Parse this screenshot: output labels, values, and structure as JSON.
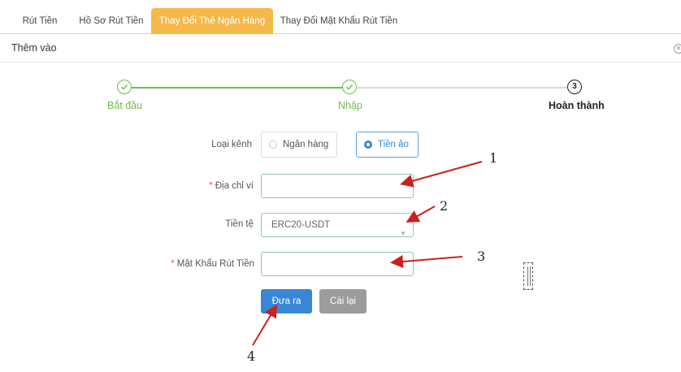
{
  "tabs": [
    {
      "label": "Rút Tiền"
    },
    {
      "label": "Hồ Sơ Rút Tiền"
    },
    {
      "label": "Thay Đổi Thẻ Ngân Hàng",
      "active": true
    },
    {
      "label": "Thay Đổi Mật Khẩu Rút Tiền"
    }
  ],
  "subheader": {
    "title": "Thêm vào"
  },
  "steps": [
    {
      "label": "Bắt đầu",
      "state": "done"
    },
    {
      "label": "Nhập",
      "state": "done"
    },
    {
      "label": "Hoàn thành",
      "state": "current",
      "number": "3"
    }
  ],
  "form": {
    "channel_label": "Loại kênh",
    "channel_options": [
      {
        "label": "Ngân hàng",
        "selected": false
      },
      {
        "label": "Tiền ảo",
        "selected": true
      }
    ],
    "wallet_label": "Địa chỉ ví",
    "wallet_value": "",
    "currency_label": "Tiền tệ",
    "currency_value": "ERC20-USDT",
    "password_label": "Mật Khẩu Rút Tiền",
    "password_value": "",
    "required_mark": "*",
    "submit_label": "Đưa ra",
    "reset_label": "Cài lại"
  },
  "annotations": [
    "1",
    "2",
    "3",
    "4"
  ],
  "colors": {
    "active_tab": "#f5b84a",
    "step_done": "#6abf4b",
    "primary_button": "#3a86d6",
    "secondary_button": "#9c9c9c",
    "annotation_arrow": "#cc1f1f"
  }
}
